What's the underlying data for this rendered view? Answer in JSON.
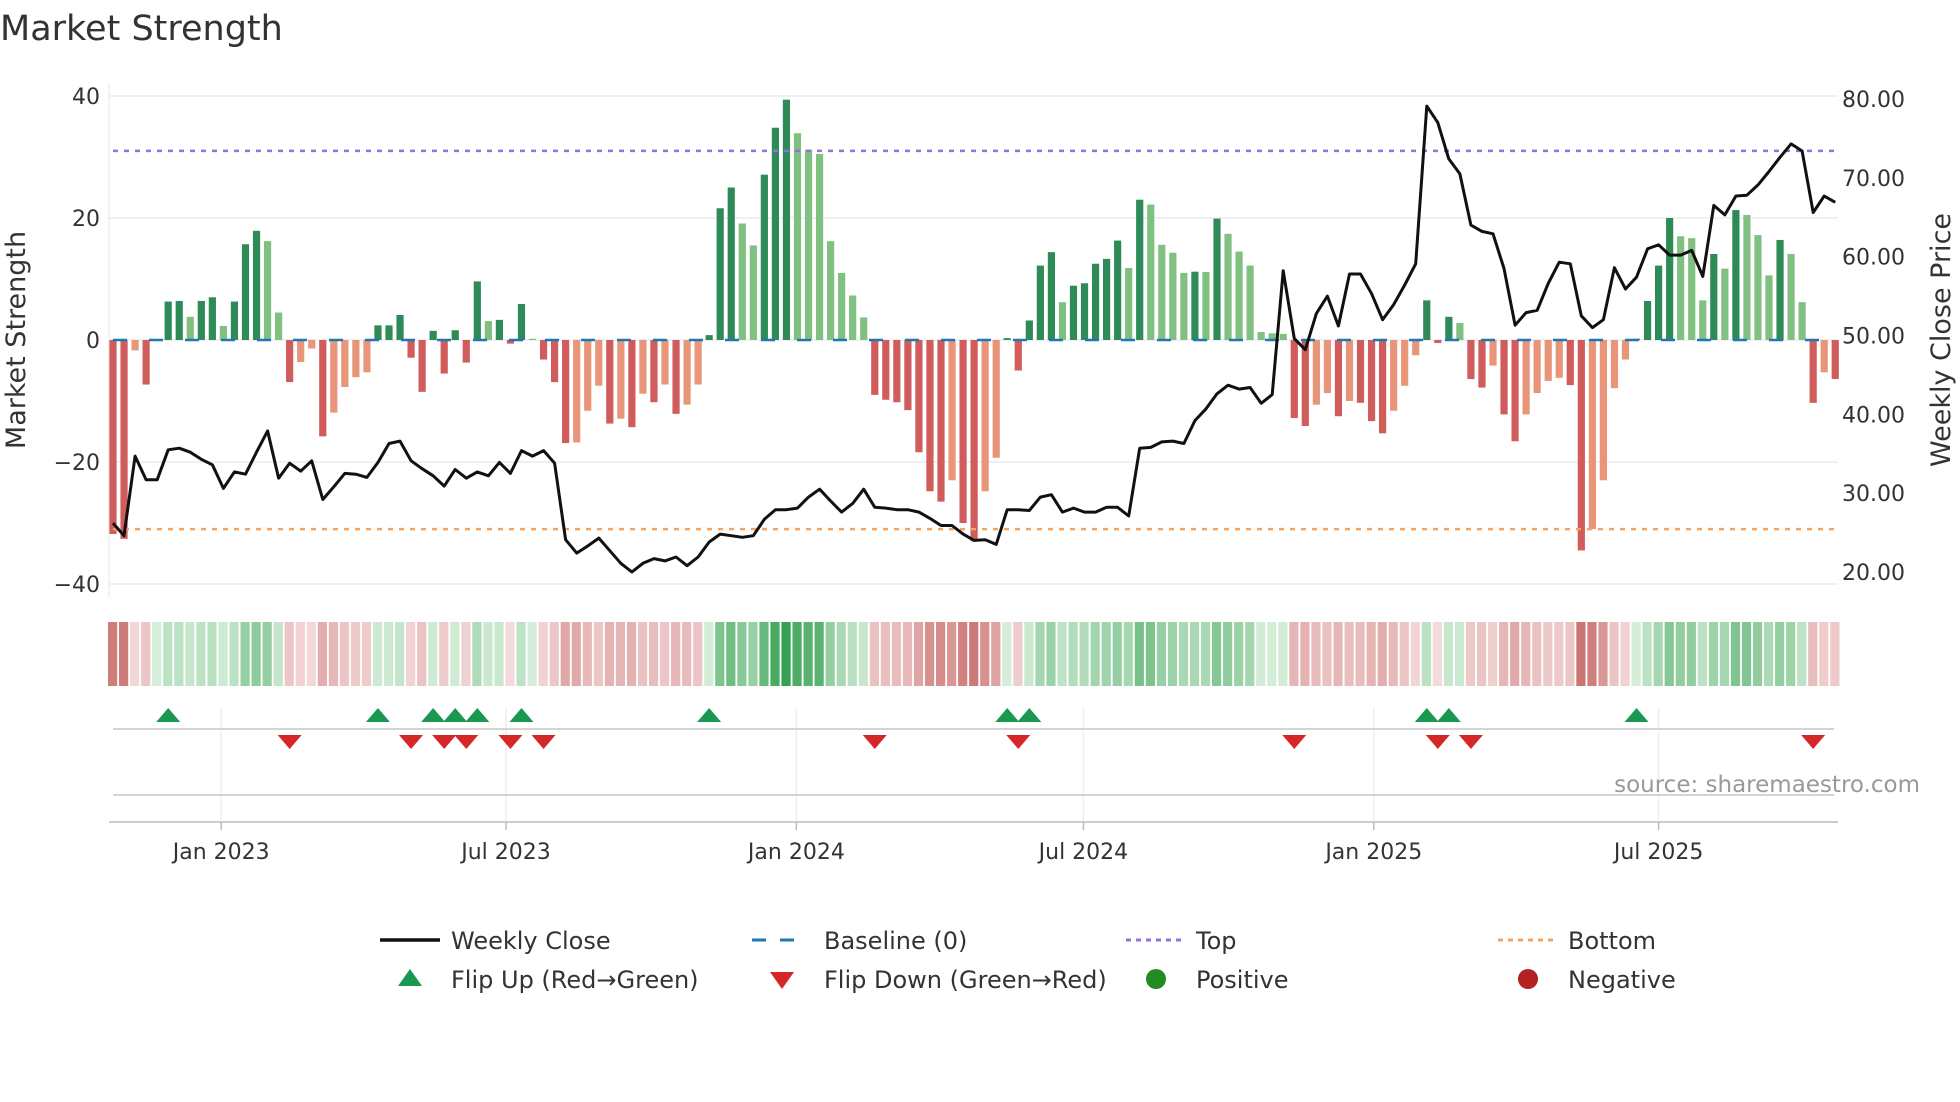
{
  "chart_data": {
    "type": "bar",
    "title": "Market Strength",
    "ylabel": "Market Strength",
    "y2label": "Weekly Close Price",
    "ylim": [
      -42,
      42
    ],
    "y2lim": [
      18.5,
      81
    ],
    "yticks": [
      "40",
      "20",
      "0",
      "−20",
      "−40"
    ],
    "ytick_values": [
      40,
      20,
      0,
      -20,
      -40
    ],
    "y2ticks": [
      "80.00",
      "70.00",
      "60.00",
      "50.00",
      "40.00",
      "30.00",
      "20.00"
    ],
    "y2tick_values": [
      80,
      70,
      60,
      50,
      40,
      30,
      20
    ],
    "xticks": [
      {
        "label": "Jan 2023",
        "week": 9.8
      },
      {
        "label": "Jul 2023",
        "week": 35.6
      },
      {
        "label": "Jan 2024",
        "week": 61.9
      },
      {
        "label": "Jul 2024",
        "week": 87.9
      },
      {
        "label": "Jan 2025",
        "week": 114.2
      },
      {
        "label": "Jul 2025",
        "week": 140.0
      }
    ],
    "top_level": 31,
    "bottom_level": -31,
    "baseline": 0,
    "grid": true,
    "strength": [
      -31.8,
      -32.6,
      -1.7,
      -7.3,
      0,
      6.3,
      6.4,
      3.8,
      6.4,
      7.0,
      2.3,
      6.3,
      15.7,
      17.9,
      16.2,
      4.5,
      -6.9,
      -3.6,
      -1.4,
      -15.8,
      -11.9,
      -7.7,
      -6.1,
      -5.3,
      2.4,
      2.4,
      4.1,
      -2.9,
      -8.5,
      1.5,
      -5.5,
      1.6,
      -3.7,
      9.6,
      3.1,
      3.3,
      -0.6,
      5.9,
      0.2,
      -3.2,
      -6.9,
      -16.9,
      -16.8,
      -11.6,
      -7.5,
      -13.7,
      -12.9,
      -14.3,
      -8.8,
      -10.2,
      -7.3,
      -12.1,
      -10.6,
      -7.3,
      0.8,
      21.6,
      25.0,
      19.1,
      15.5,
      27.1,
      34.8,
      39.4,
      33.9,
      31.2,
      30.5,
      16.2,
      11.0,
      7.3,
      3.7,
      -9.0,
      -9.8,
      -10.2,
      -11.5,
      -18.4,
      -24.8,
      -26.5,
      -23.0,
      -30.0,
      -33.0,
      -24.8,
      -19.3,
      0.3,
      -5.0,
      3.2,
      12.2,
      14.4,
      6.2,
      8.9,
      9.3,
      12.5,
      13.3,
      16.3,
      11.8,
      23.0,
      22.2,
      15.6,
      14.3,
      11.0,
      11.2,
      11.15,
      19.9,
      17.4,
      14.5,
      12.2,
      1.3,
      1.1,
      1.0,
      -12.8,
      -14.1,
      -10.6,
      -8.7,
      -12.5,
      -10.0,
      -10.3,
      -13.3,
      -15.3,
      -11.6,
      -7.5,
      -2.5,
      6.5,
      -0.5,
      3.8,
      2.8,
      -6.4,
      -7.8,
      -4.2,
      -12.2,
      -16.6,
      -12.2,
      -8.7,
      -6.7,
      -6.2,
      -7.4,
      -34.5,
      -31.0,
      -23.0,
      -7.9,
      -3.2,
      0.2,
      6.4,
      12.2,
      20.0,
      17.0,
      16.7,
      6.5,
      14.1,
      11.7,
      21.3,
      20.5,
      17.2,
      10.6,
      16.4,
      14.1,
      6.2,
      -10.3,
      -5.3,
      -6.4
    ],
    "weekly_close": [
      26.2,
      24.6,
      34.7,
      31.7,
      31.7,
      35.5,
      35.7,
      35.2,
      34.3,
      33.6,
      30.6,
      32.7,
      32.4,
      35.2,
      37.9,
      31.9,
      33.8,
      32.8,
      34.1,
      29.2,
      30.8,
      32.5,
      32.4,
      32.0,
      33.9,
      36.3,
      36.6,
      34.1,
      33.1,
      32.2,
      30.9,
      33.0,
      31.9,
      32.7,
      32.2,
      33.9,
      32.5,
      35.4,
      34.7,
      35.4,
      33.8,
      24.1,
      22.4,
      23.3,
      24.3,
      22.7,
      21.1,
      20.0,
      21.1,
      21.7,
      21.4,
      21.9,
      20.8,
      21.9,
      23.8,
      24.8,
      24.6,
      24.4,
      24.6,
      26.7,
      27.9,
      27.9,
      28.1,
      29.5,
      30.5,
      29.0,
      27.6,
      28.7,
      30.5,
      28.2,
      28.1,
      27.9,
      27.9,
      27.6,
      26.8,
      25.9,
      25.9,
      24.8,
      24.0,
      24.1,
      23.5,
      27.9,
      27.9,
      27.8,
      29.5,
      29.8,
      27.6,
      28.1,
      27.6,
      27.6,
      28.2,
      28.2,
      27.1,
      35.7,
      35.8,
      36.5,
      36.6,
      36.3,
      39.2,
      40.7,
      42.6,
      43.7,
      43.2,
      43.4,
      41.4,
      42.5,
      58.2,
      49.6,
      48.2,
      52.8,
      55.0,
      51.2,
      57.8,
      57.8,
      55.3,
      52.0,
      53.9,
      56.4,
      59.1,
      79.1,
      77.0,
      72.4,
      70.5,
      64.0,
      63.2,
      62.9,
      58.5,
      51.3,
      52.9,
      53.2,
      56.6,
      59.3,
      59.1,
      52.5,
      51.0,
      52.0,
      58.6,
      55.9,
      57.4,
      61.0,
      61.5,
      60.2,
      60.2,
      60.8,
      57.5,
      66.5,
      65.3,
      67.7,
      67.8,
      69.1,
      70.8,
      72.6,
      74.3,
      73.4,
      65.6,
      67.7,
      66.9
    ],
    "legend": {
      "placement": "bottom",
      "items": [
        {
          "label": "Weekly Close"
        },
        {
          "label": "Baseline (0)"
        },
        {
          "label": "Top"
        },
        {
          "label": "Bottom"
        },
        {
          "label": "Flip Up (Red→Green)"
        },
        {
          "label": "Flip Down (Green→Red)"
        },
        {
          "label": "Positive"
        },
        {
          "label": "Negative"
        }
      ]
    },
    "source": "source: sharemaestro.com"
  },
  "colors": {
    "pos_strong": "#2e8b57",
    "pos_weak": "#80c080",
    "neg_strong": "#d05c5c",
    "neg_weak": "#e8957a",
    "line": "#111111",
    "baseline": "#1f77b4",
    "top": "#9370db",
    "bottom": "#f4a460",
    "flip_up": "#1a9850",
    "flip_down": "#d62728",
    "positive": "#228b22",
    "negative": "#b22222"
  }
}
